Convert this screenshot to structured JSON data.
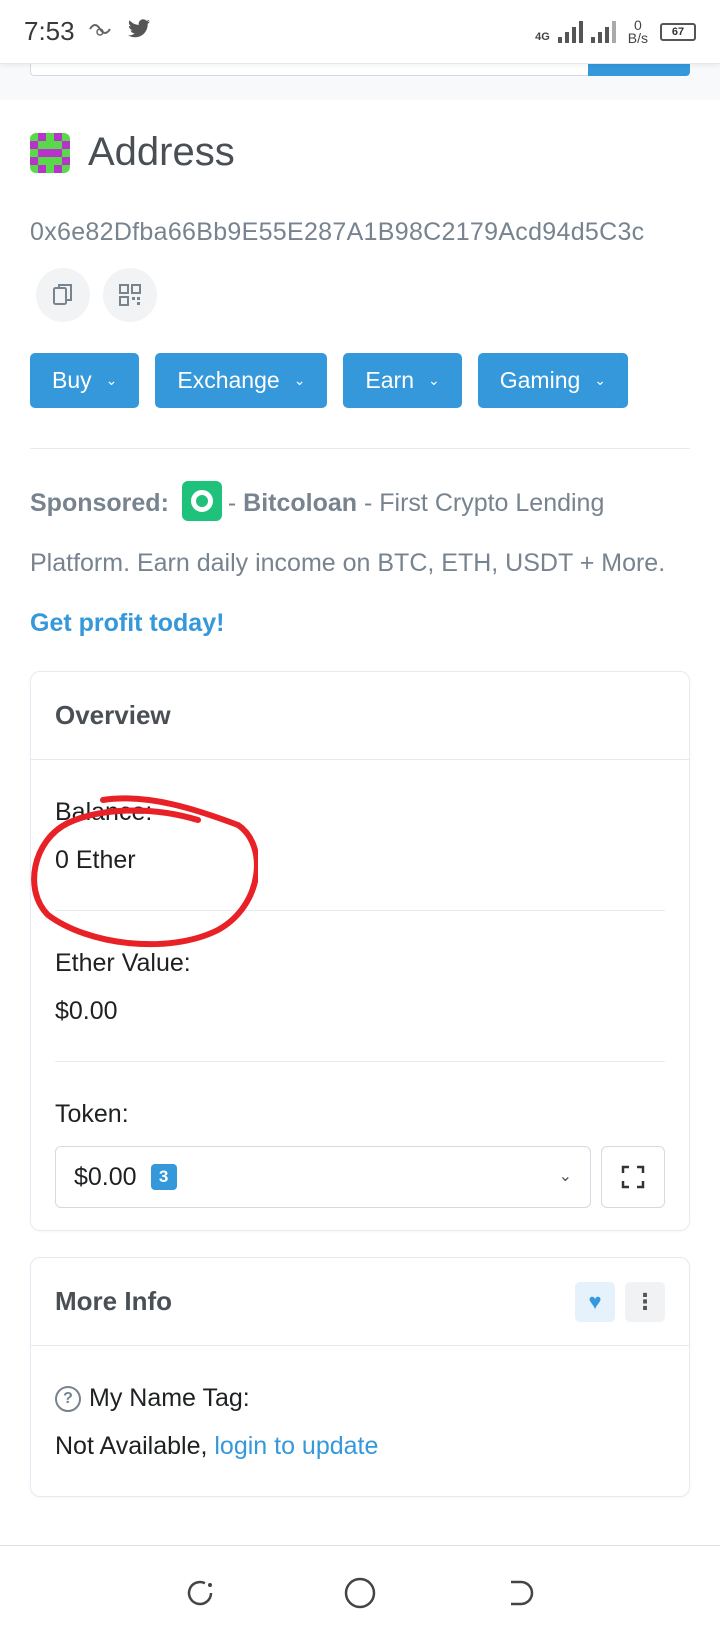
{
  "status": {
    "time": "7:53",
    "network": "4G",
    "speed_value": "0",
    "speed_unit": "B/s",
    "battery": "67"
  },
  "address": {
    "title": "Address",
    "hash": "0x6e82Dfba66Bb9E55E287A1B98C2179Acd94d5C3c"
  },
  "menu_buttons": [
    {
      "label": "Buy"
    },
    {
      "label": "Exchange"
    },
    {
      "label": "Earn"
    },
    {
      "label": "Gaming"
    }
  ],
  "sponsored": {
    "label": "Sponsored:",
    "dash1": "-",
    "brand": "Bitcoloan",
    "text": "- First Crypto Lending Platform. Earn daily income on BTC, ETH, USDT + More.",
    "cta": "Get profit today!"
  },
  "overview": {
    "title": "Overview",
    "balance_label": "Balance:",
    "balance_value": "0 Ether",
    "ether_value_label": "Ether Value:",
    "ether_value": "$0.00",
    "token_label": "Token:",
    "token_value": "$0.00",
    "token_count": "3"
  },
  "more_info": {
    "title": "More Info",
    "name_tag_label": "My Name Tag:",
    "name_tag_value": "Not Available,",
    "login_link": "login to update"
  },
  "colors": {
    "accent": "#3498db",
    "annotation": "#e82127",
    "sponsor_green": "#1ec27a"
  }
}
